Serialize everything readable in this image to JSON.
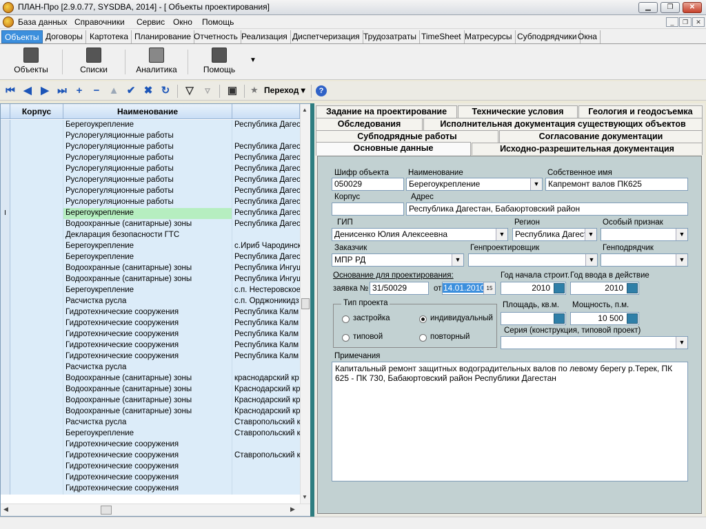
{
  "window": {
    "title": "ПЛАН-Про [2.9.0.77, SYSDBA, 2014] - [ Объекты проектирования]"
  },
  "menu": [
    "База данных",
    "Справочники",
    "Сервис",
    "Окно",
    "Помощь"
  ],
  "module_tabs": [
    "Объекты",
    "Договоры",
    "Картотека",
    "Планирование",
    "Отчетность",
    "Реализация",
    "Диспетчеризация",
    "Трудозатраты",
    "TimeSheet",
    "Матресурсы",
    "Субподрядчики",
    "Окна"
  ],
  "ribbon": {
    "buttons": [
      "Объекты",
      "Списки",
      "Аналитика",
      "Помощь"
    ]
  },
  "toolbar": {
    "navigate_label": "Переход"
  },
  "grid": {
    "columns": [
      "Корпус",
      "Наименование",
      ""
    ],
    "rows": [
      {
        "name": "Берегоукрепление",
        "region": "Республика Дагес"
      },
      {
        "name": "Русло­регуляционные работы",
        "region": ""
      },
      {
        "name": "Руслорегуляционные работы",
        "region": "Республика Дагес"
      },
      {
        "name": "Руслорегуляционные работы",
        "region": "Республика Дагес"
      },
      {
        "name": "Руслорегуляционные работы",
        "region": "Республика Дагес"
      },
      {
        "name": "Руслорегуляционные работы",
        "region": "Республика Дагес"
      },
      {
        "name": "Руслорегуляционные работы",
        "region": "Республика Дагес"
      },
      {
        "name": "Руслорегуляционные работы",
        "region": "Республика Дагес"
      },
      {
        "name": "Берегоукрепление",
        "region": "Республика Дагес",
        "selected": true
      },
      {
        "name": "Водоохранные (санитарные) зоны",
        "region": "Республика Дагес"
      },
      {
        "name": "Декларация безопасности ГТС",
        "region": ""
      },
      {
        "name": "Берегоукрепление",
        "region": "с.Ириб Чародинск"
      },
      {
        "name": "Берегоукрепление",
        "region": "Республика Дагес"
      },
      {
        "name": "Водоохранные (санитарные) зоны",
        "region": "Республика Ингуш"
      },
      {
        "name": "Водоохранные (санитарные) зоны",
        "region": "Республика Ингуш"
      },
      {
        "name": "Берегоукрепление",
        "region": "с.п. Нестеровское"
      },
      {
        "name": "Расчистка русла",
        "region": "с.п. Орджоникидз"
      },
      {
        "name": "Гидротехнические сооружения",
        "region": "Республика Калм"
      },
      {
        "name": "Гидротехнические сооружения",
        "region": "Республика Калм"
      },
      {
        "name": "Гидротехнические сооружения",
        "region": "Республика Калм"
      },
      {
        "name": "Гидротехнические сооружения",
        "region": "Республика Калм"
      },
      {
        "name": "Гидротехнические сооружения",
        "region": "Республика Калм"
      },
      {
        "name": "Расчистка русла",
        "region": ""
      },
      {
        "name": "Водоохранные (санитарные) зоны",
        "region": "краснодарский кр"
      },
      {
        "name": "Водоохранные (санитарные) зоны",
        "region": "Краснодарский кр"
      },
      {
        "name": "Водоохранные (санитарные) зоны",
        "region": "Краснодарский кр"
      },
      {
        "name": "Водоохранные (санитарные) зоны",
        "region": "Краснодарский кр"
      },
      {
        "name": "Расчистка русла",
        "region": "Ставропольский к"
      },
      {
        "name": "Берегоукрепление",
        "region": "Ставропольский к"
      },
      {
        "name": "Гидротехнические сооружения",
        "region": ""
      },
      {
        "name": "Гидротехнические сооружения",
        "region": "Ставропольский к"
      },
      {
        "name": "Гидротехнические сооружения",
        "region": ""
      },
      {
        "name": "Гидротехнические сооружения",
        "region": ""
      },
      {
        "name": "Гидротехнические сооружения",
        "region": ""
      }
    ]
  },
  "detail_tabs": {
    "row1": [
      "Задание на проектирование",
      "Технические условия",
      "Геология и геодосъемка"
    ],
    "row2": [
      "Обследования",
      "Исполнительная документация существующих объектов"
    ],
    "row3": [
      "Субподрядные работы",
      "Согласование документации"
    ],
    "row4": [
      "Основные данные",
      "Исходно-разрешительная документация"
    ]
  },
  "form": {
    "code_label": "Шифр объекта",
    "code": "050029",
    "name_label": "Наименование",
    "name": "Берегоукрепление",
    "own_name_label": "Собственное имя",
    "own_name": "Капремонт валов ПК625",
    "building_label": "Корпус",
    "building": "",
    "address_label": "Адрес",
    "address": "Республика Дагестан, Бабаюртовский район",
    "gip_label": "ГИП",
    "gip": "Денисенко Юлия Алексеевна",
    "region_label": "Регион",
    "region": "Республика Дагеста",
    "feature_label": "Особый признак",
    "feature": "",
    "customer_label": "Заказчик",
    "customer": "МПР РД",
    "gen_designer_label": "Генпроектировщик",
    "gen_designer": "",
    "gen_contractor_label": "Генподрядчик",
    "gen_contractor": "",
    "basis_label": "Основание для проектирования:",
    "request_label": "заявка №",
    "request_no": "31/50029",
    "from_label": "от",
    "request_date": "14.01.2010",
    "start_year_label": "Год начала строит.",
    "start_year": "2010",
    "commission_year_label": "Год ввода в действие",
    "commission_year": "2010",
    "project_type_label": "Тип проекта",
    "rt_building": "застройка",
    "rt_individual": "индивидуальный",
    "rt_typical": "типовой",
    "rt_repeated": "повторный",
    "area_label": "Площадь, кв.м.",
    "area": "",
    "power_label": "Мощность, п.м.",
    "power": "10 500",
    "series_label": "Серия (конструкция, типовой проект)",
    "series": "",
    "notes_label": "Примечания",
    "notes": "Капитальный ремонт защитных водоградительных валов по левому берегу р.Терек, ПК 625 - ПК 730, Бабаюртовский район Республики Дагестан"
  }
}
